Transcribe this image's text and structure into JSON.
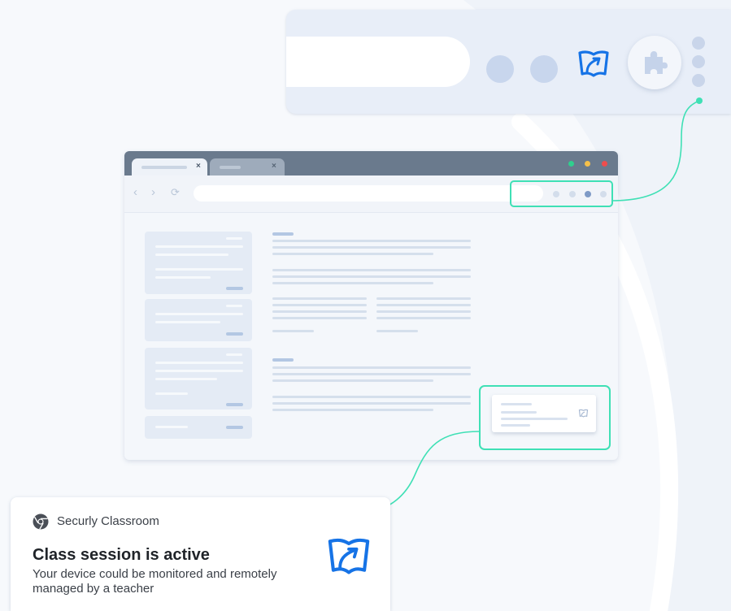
{
  "colors": {
    "accent_teal": "#3fe0b5",
    "securly_blue": "#1673e6",
    "titlebar": "#6a7a8d",
    "window_close": "#ef4d4d",
    "window_minimize": "#f5c04a",
    "window_maximize": "#2fcf8e"
  },
  "icons": {
    "extension": "securly-classroom-icon",
    "puzzle": "extensions-puzzle-icon",
    "chrome": "chrome-icon",
    "menu": "menu-dots-icon"
  },
  "browser": {
    "tabs": [
      {
        "close_glyph": "×"
      },
      {
        "close_glyph": "×"
      }
    ],
    "nav": {
      "back": "‹",
      "forward": "›",
      "reload": "⟳"
    }
  },
  "notification": {
    "app_name": "Securly Classroom",
    "title": "Class session is active",
    "body": "Your device could be monitored and remotely managed by a teacher"
  }
}
